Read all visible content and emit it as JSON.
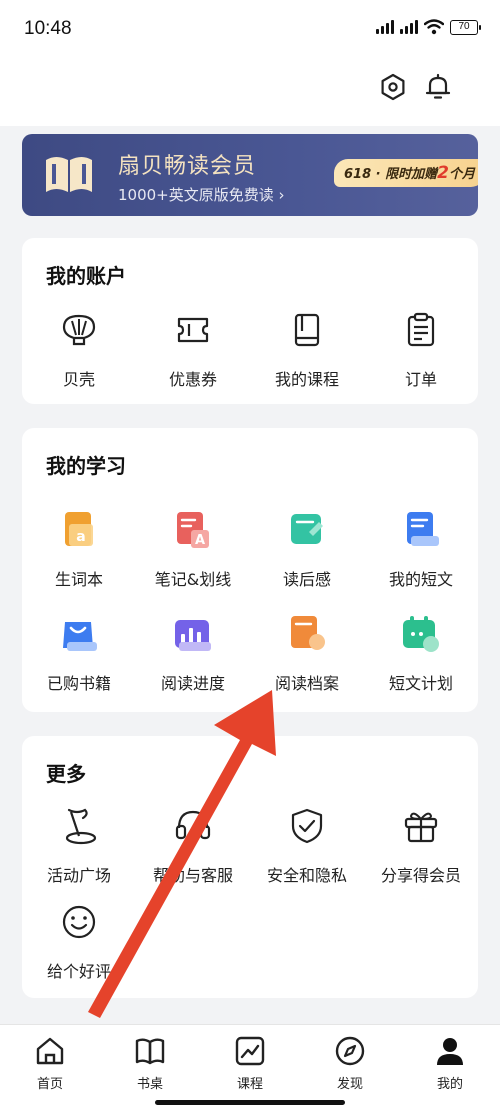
{
  "status_bar": {
    "time": "10:48",
    "battery": "70"
  },
  "vip": {
    "title": "扇贝畅读会员",
    "subtitle": "1000+英文原版免费读 ›",
    "promo_prefix": "618 · 限时加赠",
    "promo_number": "2",
    "promo_suffix": "个月"
  },
  "account": {
    "title": "我的账户",
    "items": [
      {
        "label": "贝壳",
        "icon": "shell-icon"
      },
      {
        "label": "优惠券",
        "icon": "coupon-icon"
      },
      {
        "label": "我的课程",
        "icon": "course-book-icon"
      },
      {
        "label": "订单",
        "icon": "order-clipboard-icon"
      }
    ]
  },
  "study": {
    "title": "我的学习",
    "items": [
      {
        "label": "生词本",
        "icon": "vocab-book-icon",
        "color": "#f0a030"
      },
      {
        "label": "笔记&划线",
        "icon": "notes-icon",
        "color": "#e8615d"
      },
      {
        "label": "读后感",
        "icon": "review-icon",
        "color": "#33c3a3"
      },
      {
        "label": "我的短文",
        "icon": "essay-icon",
        "color": "#3d7cf0"
      },
      {
        "label": "已购书籍",
        "icon": "purchased-bag-icon",
        "color": "#3d7cf0"
      },
      {
        "label": "阅读进度",
        "icon": "progress-chart-icon",
        "color": "#7462e8"
      },
      {
        "label": "阅读档案",
        "icon": "archive-icon",
        "color": "#f08a3a"
      },
      {
        "label": "短文计划",
        "icon": "plan-calendar-icon",
        "color": "#2cbf8e"
      }
    ]
  },
  "more": {
    "title": "更多",
    "items": [
      {
        "label": "活动广场",
        "icon": "flag-icon"
      },
      {
        "label": "帮助与客服",
        "icon": "headset-icon"
      },
      {
        "label": "安全和隐私",
        "icon": "shield-check-icon"
      },
      {
        "label": "分享得会员",
        "icon": "gift-icon"
      },
      {
        "label": "给个好评",
        "icon": "smile-icon"
      }
    ]
  },
  "nav": {
    "items": [
      {
        "label": "首页",
        "icon": "home-icon"
      },
      {
        "label": "书桌",
        "icon": "open-book-icon"
      },
      {
        "label": "课程",
        "icon": "chart-square-icon"
      },
      {
        "label": "发现",
        "icon": "compass-icon"
      },
      {
        "label": "我的",
        "icon": "user-icon"
      }
    ]
  },
  "colors": {
    "accent_arrow": "#e5432b",
    "banner": "#46528d",
    "promo_number": "#e03b2b"
  }
}
